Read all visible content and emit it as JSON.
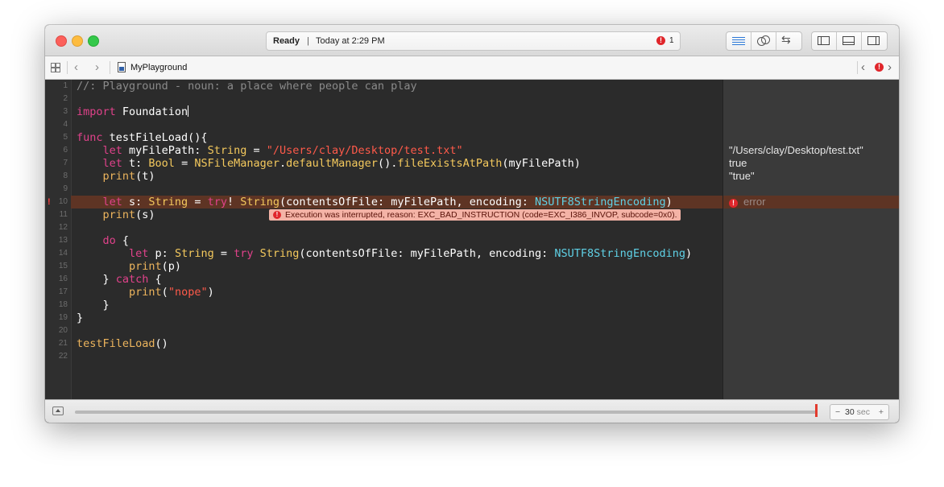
{
  "titlebar": {
    "status": "Ready",
    "separator": "|",
    "time": "Today at 2:29 PM",
    "error_count": "1",
    "error_glyph": "!"
  },
  "toolbar_icons": {
    "editor": [
      "standard-editor-icon",
      "assistant-editor-icon",
      "version-editor-icon"
    ],
    "views": [
      "navigator-toggle-icon",
      "debug-area-toggle-icon",
      "utilities-toggle-icon"
    ]
  },
  "jumpbar": {
    "back": "‹",
    "forward": "›",
    "file_name": "MyPlayground",
    "issue_prev": "‹",
    "issue_next": "›",
    "error_glyph": "!"
  },
  "editor": {
    "line_numbers": [
      "1",
      "2",
      "3",
      "4",
      "5",
      "6",
      "7",
      "8",
      "9",
      "10",
      "11",
      "12",
      "13",
      "14",
      "15",
      "16",
      "17",
      "18",
      "19",
      "20",
      "21",
      "22"
    ],
    "error_line_marker": "!",
    "banner": "Execution was interrupted, reason: EXC_BAD_INSTRUCTION (code=EXC_I386_INVOP, subcode=0x0).",
    "banner_glyph": "!"
  },
  "results": {
    "line6": "\"/Users/clay/Desktop/test.txt\"",
    "line7": "true",
    "line8": "\"true\"",
    "line10": "error",
    "error_glyph": "!"
  },
  "bottombar": {
    "minus": "−",
    "value": "30",
    "unit": "sec",
    "plus": "+"
  },
  "colors": {
    "keyword": "#e1428b",
    "type": "#f4c95d",
    "string": "#ff5a4a",
    "class": "#5fd1e6",
    "comment": "#8a8a8a",
    "error_line": "#5e3424",
    "banner": "#f4b3a6"
  }
}
